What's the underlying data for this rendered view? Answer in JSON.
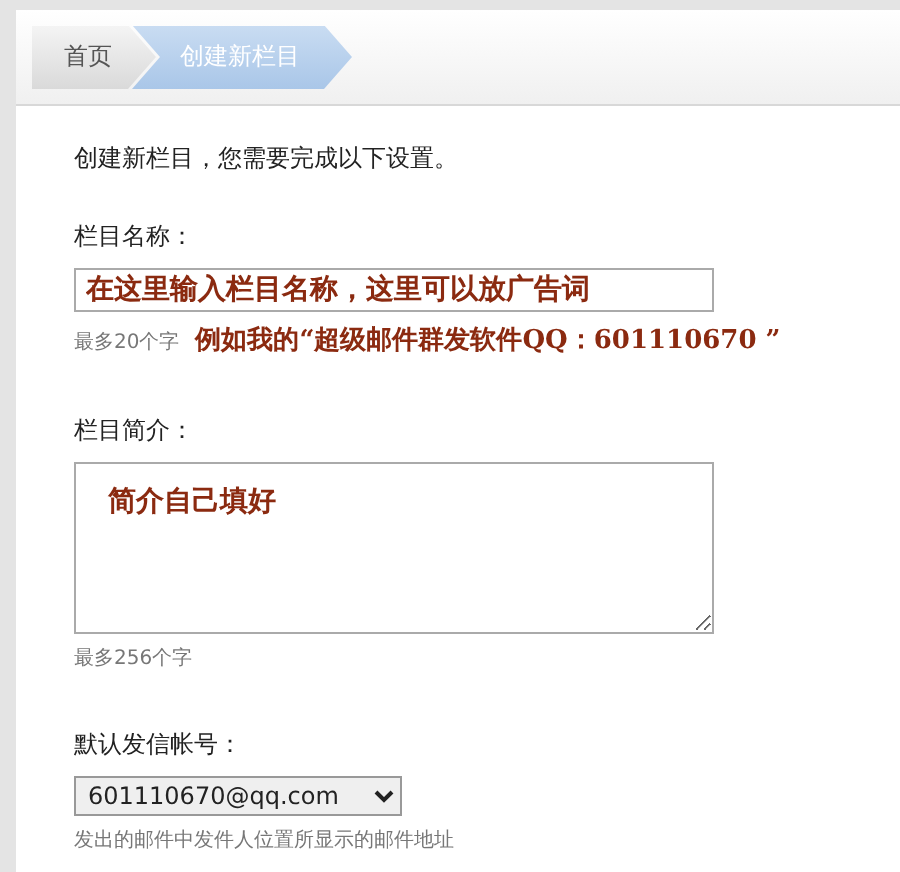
{
  "breadcrumb": [
    {
      "label": "首页",
      "selected": false
    },
    {
      "label": "创建新栏目",
      "selected": true
    }
  ],
  "intro": "创建新栏目，您需要完成以下设置。",
  "fields": [
    {
      "kind": "text",
      "label": "栏目名称：",
      "value": "在这里输入栏目名称，这里可以放广告词",
      "hint": "最多20个字",
      "annotation": "例如我的“超级邮件群发软件QQ：601110670 ”"
    },
    {
      "kind": "textarea",
      "label": "栏目简介：",
      "value": "简介自己填好",
      "hint": "最多256个字"
    },
    {
      "kind": "select",
      "label": "默认发信帐号：",
      "value": "601110670@qq.com",
      "hint": "发出的邮件中发件人位置所显示的邮件地址"
    }
  ]
}
